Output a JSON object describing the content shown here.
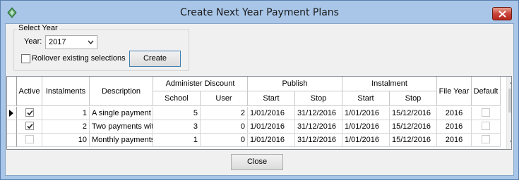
{
  "window": {
    "title": "Create Next Year Payment Plans"
  },
  "select_year": {
    "legend": "Select Year",
    "year_label": "Year:",
    "year_value": "2017",
    "rollover_label": "Rollover existing selections",
    "rollover_checked": false,
    "create_label": "Create"
  },
  "grid": {
    "headers": {
      "active": "Active",
      "instalments": "Instalments",
      "description": "Description",
      "administer_discount": "Administer Discount",
      "school": "School",
      "user": "User",
      "publish": "Publish",
      "instalment": "Instalment",
      "start": "Start",
      "stop": "Stop",
      "file_year": "File Year",
      "default": "Default"
    },
    "rows": [
      {
        "active": true,
        "instalments": "1",
        "description": "A single payment",
        "school": "5",
        "user": "2",
        "publish_start": "1/01/2016",
        "publish_stop": "31/12/2016",
        "inst_start": "1/01/2016",
        "inst_stop": "15/12/2016",
        "file_year": "2016",
        "default": false
      },
      {
        "active": true,
        "instalments": "2",
        "description": "Two payments wit",
        "school": "3",
        "user": "0",
        "publish_start": "1/01/2016",
        "publish_stop": "31/12/2016",
        "inst_start": "1/01/2016",
        "inst_stop": "15/12/2016",
        "file_year": "2016",
        "default": false
      },
      {
        "active": false,
        "instalments": "10",
        "description": "Monthly payments",
        "school": "1",
        "user": "0",
        "publish_start": "1/01/2016",
        "publish_stop": "31/12/2016",
        "inst_start": "1/01/2016",
        "inst_stop": "15/12/2016",
        "file_year": "2016",
        "default": false
      }
    ]
  },
  "footer": {
    "close_label": "Close"
  },
  "colors": {
    "frame": "#a9c6e8",
    "client": "#f0f0f0",
    "accent": "#3c7fb1"
  }
}
